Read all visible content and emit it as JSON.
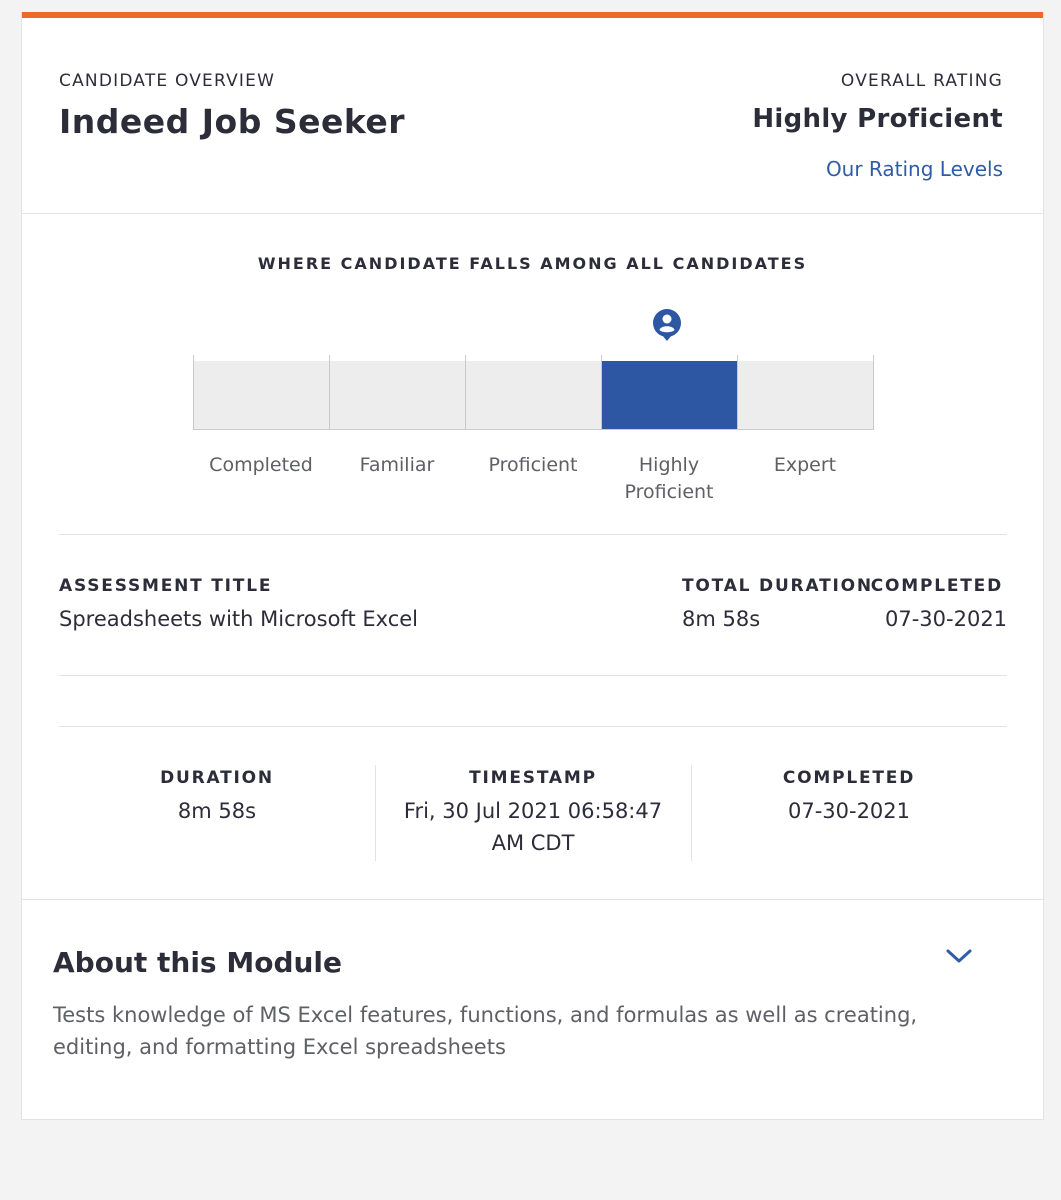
{
  "header": {
    "candidate_overview_label": "CANDIDATE OVERVIEW",
    "candidate_name": "Indeed Job Seeker",
    "overall_rating_label": "OVERALL RATING",
    "overall_rating_value": "Highly Proficient",
    "rating_levels_link": "Our Rating Levels"
  },
  "distribution": {
    "title": "WHERE CANDIDATE FALLS AMONG ALL CANDIDATES",
    "levels": [
      {
        "label_line1": "Completed",
        "label_line2": ""
      },
      {
        "label_line1": "Familiar",
        "label_line2": ""
      },
      {
        "label_line1": "Proficient",
        "label_line2": ""
      },
      {
        "label_line1": "Highly",
        "label_line2": "Proficient"
      },
      {
        "label_line1": "Expert",
        "label_line2": ""
      }
    ],
    "active_index": 3,
    "marker_icon": "user-location-pin-icon",
    "active_color": "#2d57a3",
    "inactive_color": "#ededed"
  },
  "assessment": {
    "title_label": "ASSESSMENT TITLE",
    "title_value": "Spreadsheets with Microsoft Excel",
    "total_duration_label": "TOTAL DURATION",
    "total_duration_value": "8m 58s",
    "completed_label": "COMPLETED",
    "completed_value": "07-30-2021"
  },
  "details": {
    "duration_label": "DURATION",
    "duration_value": "8m 58s",
    "timestamp_label": "TIMESTAMP",
    "timestamp_line1": "Fri, 30 Jul 2021 06:58:47",
    "timestamp_line2": "AM CDT",
    "completed_label": "COMPLETED",
    "completed_value": "07-30-2021"
  },
  "about": {
    "title": "About this Module",
    "description": "Tests knowledge of MS Excel features, functions, and formulas as well as creating, editing, and formatting Excel spreadsheets",
    "toggle_icon": "chevron-down-icon"
  },
  "colors": {
    "accent_bar": "#f0672a",
    "link": "#2f5ca8",
    "text": "#2d2d3a"
  }
}
